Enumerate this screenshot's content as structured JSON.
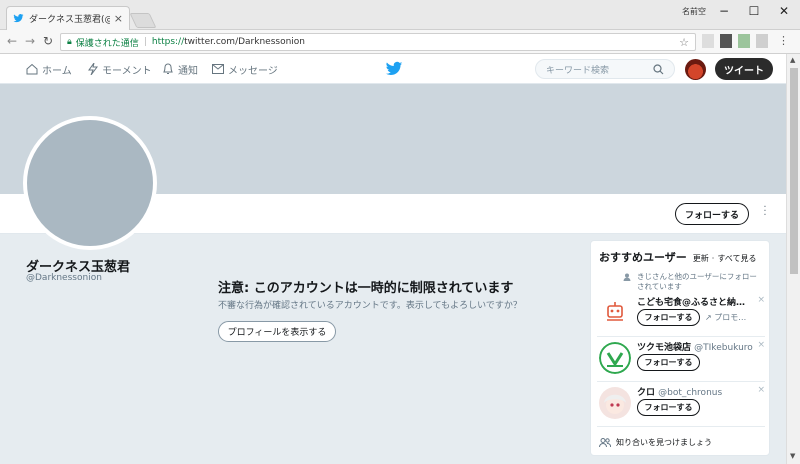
{
  "browser": {
    "tab_title": "ダークネス玉葱君(@Darkness",
    "tab_close": "×",
    "window_label": "名前空",
    "win_min": "−",
    "win_max": "☐",
    "win_close": "✕",
    "secure_label": "保護された通信",
    "url_scheme": "https://",
    "url_rest": "twitter.com/Darknessonion"
  },
  "topnav": {
    "home": "ホーム",
    "moments": "モーメント",
    "notifications": "通知",
    "messages": "メッセージ",
    "search_placeholder": "キーワード検索",
    "tweet_button": "ツイート"
  },
  "profile": {
    "name": "ダークネス玉葱君",
    "handle": "@Darknessonion",
    "follow_button": "フォローする"
  },
  "notice": {
    "title": "注意: このアカウントは一時的に制限されています",
    "subtitle": "不審な行為が確認されているアカウントです。表示してもよろしいですか？",
    "show_button": "プロフィールを表示する"
  },
  "sidebar": {
    "title": "おすすめユーザー",
    "refresh": "更新",
    "view_all": "すべて見る",
    "context": "きじさんと他のユーザーにフォローされています",
    "recommendations": [
      {
        "name": "こども宅食@ふるさと納…",
        "handle": "",
        "follow": "フォローする",
        "extra": "プロモ…"
      },
      {
        "name": "ツクモ池袋店",
        "handle": "@TIkebukuro",
        "follow": "フォローする",
        "extra": ""
      },
      {
        "name": "クロ",
        "handle": "@bot_chronus",
        "follow": "フォローする",
        "extra": ""
      }
    ],
    "find_friends": "知り合いを見つけましょう"
  },
  "colors": {
    "twitter_blue": "#1da1f2",
    "banner": "#ccd6dd",
    "background": "#e6ecf0",
    "secure_green": "#0b8043"
  }
}
